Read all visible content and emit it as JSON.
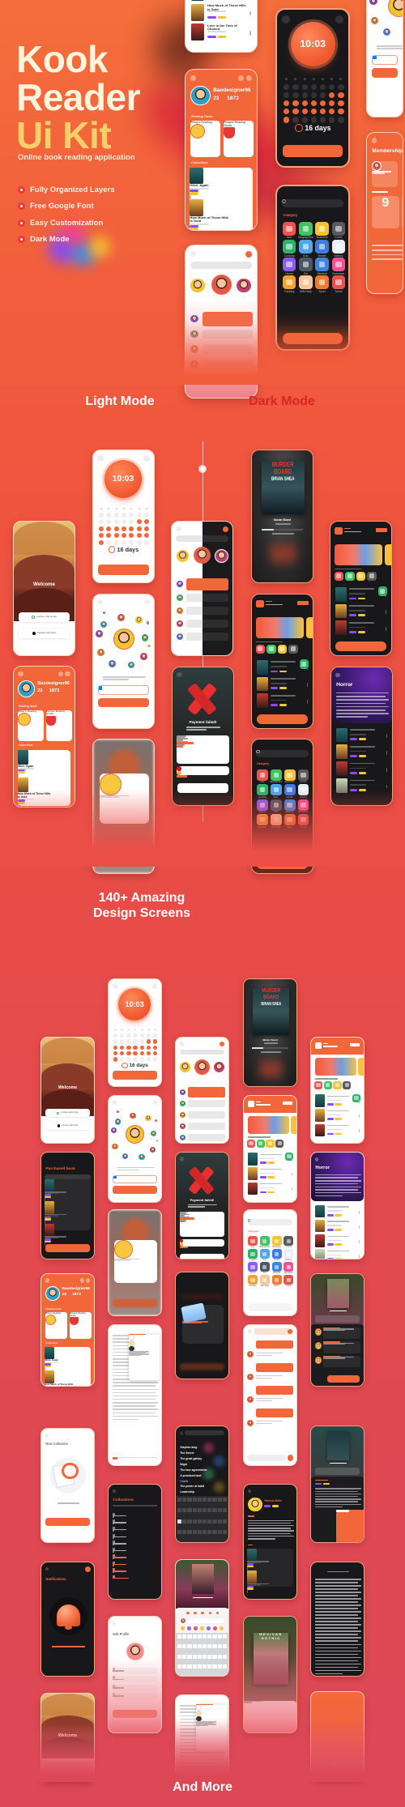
{
  "hero": {
    "title_line1": "Kook",
    "title_line2": "Reader",
    "title_line3": "Ui Kit",
    "subtitle": "Online book reading application",
    "features": [
      {
        "label": "Fully Organized Layers",
        "icon": "layers-icon"
      },
      {
        "label": "Free Google Font",
        "icon": "font-icon"
      },
      {
        "label": "Easy Customization",
        "icon": "customize-icon"
      },
      {
        "label": "Dark Mode",
        "icon": "moon-icon"
      }
    ]
  },
  "modes": {
    "light": "Light Mode",
    "dark": "Dark Mode"
  },
  "screens_heading": {
    "line1": "140+ Amazing",
    "line2": "Design Screens"
  },
  "footer": {
    "label": "And More"
  },
  "colors": {
    "accent": "#f2673a",
    "dark_mode_label": "#d92525",
    "title_cream": "#fff4dc",
    "title_yellow": "#f9cf6b",
    "tag_purple": "#8a4cf0",
    "tag_yellow": "#f7c531"
  },
  "categories": [
    {
      "label": "Arts",
      "color": "#ef5350",
      "icon": "palette-icon"
    },
    {
      "label": "Biographies",
      "color": "#43c463",
      "icon": "quill-icon"
    },
    {
      "label": "Business",
      "color": "#f5c330",
      "icon": "briefcase-icon"
    },
    {
      "label": "Comic",
      "color": "#5a5a5e",
      "icon": "comic-icon"
    },
    {
      "label": "Cooking",
      "color": "#2fb36a",
      "icon": "pan-icon"
    },
    {
      "label": "Edu",
      "color": "#4fa6ea",
      "icon": "school-icon"
    },
    {
      "label": "Health",
      "color": "#3d7be0",
      "icon": "pill-icon"
    },
    {
      "label": "History",
      "color": "#e8eefa",
      "icon": "scroll-icon"
    },
    {
      "label": "Horror",
      "color": "#8a5cf0",
      "icon": "ghost-icon"
    },
    {
      "label": "Kid",
      "color": "#4a5866",
      "icon": "toy-icon"
    },
    {
      "label": "Medical",
      "color": "#3d86e0",
      "icon": "doctor-icon"
    },
    {
      "label": "Romance",
      "color": "#f0509a",
      "icon": "heart-icon"
    },
    {
      "label": "Fantasy",
      "color": "#f7a02c",
      "icon": "magic-icon"
    },
    {
      "label": "Self-Help",
      "color": "#f9c69a",
      "icon": "hand-icon"
    },
    {
      "label": "Sport",
      "color": "#f07a2c",
      "icon": "trophy-icon"
    },
    {
      "label": "Travel",
      "color": "#e5534b",
      "icon": "balloon-icon"
    }
  ],
  "phones": [
    {
      "screen": "booklist",
      "theme": "light",
      "books": [
        {},
        {
          "title": "How Much of These Hills is Gold"
        },
        {
          "title": "Love in the Time of Cholera"
        }
      ]
    },
    {
      "screen": "profile",
      "theme": "orange",
      "name": "Baodesigner96",
      "stat1": "23",
      "stat2": "1873",
      "goals": "Reading Goals",
      "card1": "Today's Reading",
      "card2": "Longest Reading Streak",
      "collections": "Collections",
      "books": [
        {
          "title": "Olive, Again"
        },
        {
          "title": "How Much of These Hills is Gold"
        }
      ]
    },
    {
      "screen": "chat",
      "theme": "light",
      "fade": true
    },
    {
      "screen": "timer",
      "theme": "dark",
      "time": "10:03",
      "streak": "16 days"
    },
    {
      "screen": "category",
      "theme": "dark",
      "heading": "Category"
    },
    {
      "screen": "social",
      "theme": "light"
    },
    {
      "screen": "membership",
      "theme": "orange",
      "title": "Membership",
      "price": "9"
    },
    {
      "screen": "welcome",
      "theme": "light",
      "title": "Welcome",
      "google": "Continue with Google",
      "apple": "Continue with Apple"
    },
    {
      "screen": "profile",
      "theme": "orange",
      "name": "Baodesigner96",
      "stat1": "23",
      "stat2": "1873",
      "goals": "Reading Goals",
      "card1": "Today's Reading",
      "card2": "Longest Reading Streak",
      "collections": "Collections",
      "books": [
        {
          "title": "Olive, Again"
        },
        {
          "title": "How Much of These Hills is Gold"
        }
      ]
    },
    {
      "screen": "timer",
      "theme": "light",
      "time": "10:03",
      "streak": "16 days"
    },
    {
      "screen": "social",
      "theme": "light"
    },
    {
      "screen": "stopwatch",
      "theme": "light"
    },
    {
      "screen": "chat",
      "theme": "light",
      "split": true
    },
    {
      "screen": "payment",
      "theme": "dark",
      "title": "Payment failed!"
    },
    {
      "screen": "murder",
      "theme": "dark",
      "cover_line1": "MURDER",
      "cover_line2": "BOARD",
      "author": "BRIAN SHEA",
      "title": "Murder Board"
    },
    {
      "screen": "home",
      "theme": "dark"
    },
    {
      "screen": "category",
      "theme": "dark",
      "heading": "Category"
    },
    {
      "screen": "home",
      "theme": "dark"
    },
    {
      "screen": "horror",
      "theme": "dark",
      "title": "Horror"
    },
    {
      "screen": "welcome",
      "theme": "light",
      "title": "Welcome",
      "google": "Continue with Google",
      "apple": "Continue with Apple"
    },
    {
      "screen": "purchased",
      "theme": "dark",
      "title": "Purchased book"
    },
    {
      "screen": "profile",
      "theme": "orange",
      "name": "Baodesigner96",
      "stat1": "23",
      "stat2": "1873",
      "goals": "Reading Goals",
      "card1": "Today's Reading",
      "card2": "Longest Reading Streak",
      "collections": "Collections",
      "books": [
        {
          "title": "Olive, Again"
        },
        {
          "title": "How Much of These Hills is Gold"
        }
      ]
    },
    {
      "screen": "newcollection",
      "theme": "light",
      "title": "New Collection"
    },
    {
      "screen": "notifications",
      "theme": "dark",
      "title": "Notifications"
    },
    {
      "screen": "welcome",
      "theme": "light",
      "title": "Welcome",
      "fade": true
    },
    {
      "screen": "timer",
      "theme": "light",
      "time": "10:03",
      "streak": "16 days"
    },
    {
      "screen": "social",
      "theme": "light"
    },
    {
      "screen": "stopwatch",
      "theme": "light"
    },
    {
      "screen": "reader",
      "theme": "light"
    },
    {
      "screen": "collections",
      "theme": "dark",
      "title": "Collections"
    },
    {
      "screen": "editprofile",
      "theme": "light",
      "title": "Edit Profile",
      "fade": true
    },
    {
      "screen": "chat",
      "theme": "light"
    },
    {
      "screen": "payment",
      "theme": "dark",
      "title": "Payment failed!"
    },
    {
      "screen": "email",
      "theme": "dark"
    },
    {
      "screen": "search",
      "theme": "dark",
      "items": [
        "Stephen king",
        "The Secret",
        "The great gatsby",
        "Ikigai",
        "The four agreements",
        "A promised land",
        "Castle",
        "The power of habit",
        "Leadership"
      ]
    },
    {
      "screen": "review",
      "theme": "light"
    },
    {
      "screen": "reader",
      "theme": "light",
      "fade": true
    },
    {
      "screen": "murder",
      "theme": "dark",
      "cover_line1": "MURDER",
      "cover_line2": "BOARD",
      "author": "BRIAN SHEA",
      "title": "Murder Board"
    },
    {
      "screen": "home",
      "theme": "light"
    },
    {
      "screen": "category",
      "theme": "light",
      "heading": "Category"
    },
    {
      "screen": "chat2",
      "theme": "light"
    },
    {
      "screen": "author",
      "theme": "dark",
      "name": "Patricia Miller"
    },
    {
      "screen": "gothic",
      "theme": "dark",
      "cover_line1": "MEXICAN",
      "cover_line2": "GOTHIC",
      "fade": true
    },
    {
      "screen": "home",
      "theme": "light"
    },
    {
      "screen": "horror",
      "theme": "light",
      "title": "Horror"
    },
    {
      "screen": "bookdetail",
      "theme": "dark",
      "cover": "gothic"
    },
    {
      "screen": "bookdetail",
      "theme": "dark",
      "cover": "murder"
    },
    {
      "screen": "readergray",
      "theme": "dark"
    },
    {
      "screen": "splash",
      "theme": "orange",
      "fade": true
    }
  ]
}
